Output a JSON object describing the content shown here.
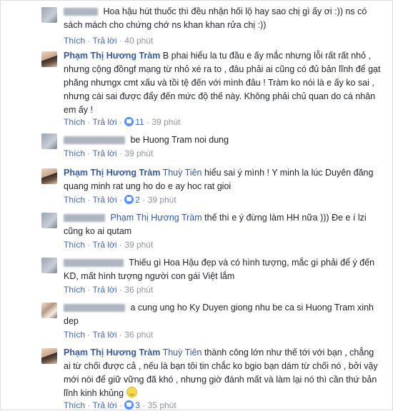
{
  "ui": {
    "like": "Thích",
    "reply": "Trả lời",
    "dot": "·"
  },
  "comments": [
    {
      "author": "",
      "tag": "",
      "text": "Hoa hậu hút thuốc thì đều nhận hối lộ hay sao chị gì ấy ơi :)) ns có sách mách cho chứng chớ ns khan khan rửa chị :))",
      "reactions": "",
      "time": "40 phút"
    },
    {
      "author": "Phạm Thị Hương Tràm",
      "tag": "",
      "text": "B phai hiểu la tu đầu e ấy mắc nhưng lỗi rất rất nhỏ , nhưng cộng đồngf mạng từ nhỏ xé ra to , đâu phải ai cũng có đủ bản lĩnh để gạt phăng nhưngx cmt xấu và tồi tệ đến với mình đâu ! Tràm ko nói là e ấy ko sai , nhưng cái sai được đẩy đến mức độ thế này. Không phải chủ quan do cá nhân em ấy !",
      "reactions": "11",
      "time": "39 phút"
    },
    {
      "author": "",
      "tag": "",
      "text": "be Huong Tram noi dung",
      "reactions": "",
      "time": "39 phút"
    },
    {
      "author": "Phạm Thị Hương Tràm",
      "tag": "Thuỳ Tiên",
      "text": "hiểu sai ý mình ! Y minh la lúc Duyên đăng quang minh rat ung ho do e ay hoc rat gioi",
      "reactions": "2",
      "time": "39 phút"
    },
    {
      "author": "",
      "tag": "Phạm Thị Hương Tràm",
      "text": "thế thì e ý đừng làm HH nữa ))) Đe e í lzi cũng ko ai qutam",
      "reactions": "",
      "time": "39 phút"
    },
    {
      "author": "",
      "tag": "",
      "text": "Thiếu gì Hoa Hậu đẹp và có hình tượng, mắc gì phải để ý đến KD, mất hình tượng người con gái Việt lắm",
      "reactions": "",
      "time": "36 phút"
    },
    {
      "author": "",
      "tag": "",
      "text": "a cung ung ho Ky Duyen giong nhu be ca si Huong Tram xinh dep",
      "reactions": "",
      "time": "36 phút"
    },
    {
      "author": "Phạm Thị Hương Tràm",
      "tag": "Thuỳ Tiên",
      "text": "thành công lớn như thế tới với bạn , chẳng ai từ chối được cả , nếu là bạn tôi tin chắc ko bgio bạn dám từ chối nó , bởi vậy mới nói để giữ vững đã khó , nhưng giờ đánh mất và làm lại nó thì cần thứ bản lĩnh kinh khủng",
      "reactions": "3",
      "time": "35 phút"
    }
  ]
}
